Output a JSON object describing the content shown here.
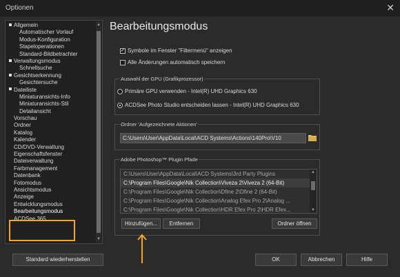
{
  "window": {
    "title": "Optionen",
    "close_glyph": "✕"
  },
  "sidebar": {
    "items": [
      {
        "label": "Allgemein",
        "level": 0,
        "square": true
      },
      {
        "label": "Automatischer Vorlauf",
        "level": 1
      },
      {
        "label": "Modus-Konfiguration",
        "level": 1
      },
      {
        "label": "Stapeloperationen",
        "level": 1
      },
      {
        "label": "Standard-Bildbetrachter",
        "level": 1
      },
      {
        "label": "Verwaltungsmodus",
        "level": 0,
        "square": true
      },
      {
        "label": "Schnellsuche",
        "level": 1
      },
      {
        "label": "Gesichtserkennung",
        "level": 0,
        "square": true
      },
      {
        "label": "Gesichtersuche",
        "level": 1
      },
      {
        "label": "Dateiliste",
        "level": 0,
        "square": true
      },
      {
        "label": "Miniaturansichts-Info",
        "level": 1
      },
      {
        "label": "Miniaturansichts-Stil",
        "level": 1
      },
      {
        "label": "Detailansicht",
        "level": 1
      },
      {
        "label": "Vorschau",
        "level": 0
      },
      {
        "label": "Ordner",
        "level": 0
      },
      {
        "label": "Katalog",
        "level": 0
      },
      {
        "label": "Kalender",
        "level": 0
      },
      {
        "label": "CD/DVD-Verwaltung",
        "level": 0
      },
      {
        "label": "Eigenschaftsfenster",
        "level": 0
      },
      {
        "label": "Dateiverwaltung",
        "level": 0
      },
      {
        "label": "Farbmanagement",
        "level": 0
      },
      {
        "label": "Datenbank",
        "level": 0
      },
      {
        "label": "Fotomodus",
        "level": 0
      },
      {
        "label": "Ansichtsmodus",
        "level": 0
      },
      {
        "label": "Anzeige",
        "level": 0
      },
      {
        "label": "Entwicklungsmodus",
        "level": 0
      },
      {
        "label": "Bearbeitungsmodus",
        "level": 0,
        "selected": true
      },
      {
        "label": "ACDSee 365",
        "level": 0
      }
    ]
  },
  "main": {
    "heading": "Bearbeitungsmodus",
    "checkbox1": {
      "label": "Symbole im Fenster \"Filtermenü\" anzeigen",
      "checked": true
    },
    "checkbox2": {
      "label": "Alle Änderungen automatisch speichern",
      "checked": false
    },
    "gpu_group": {
      "title": "Auswahl der GPU (Grafikprozessor)",
      "option1": "Primäre GPU verwenden - Intel(R) UHD Graphics 630",
      "option2": "ACDSee Photo Studio entscheiden lassen - Intel(R) UHD Graphics 630",
      "selected": 2
    },
    "actions_group": {
      "title": "Ordner 'Aufgezeichnete Aktionen'",
      "path": "C:\\Users\\User\\AppData\\Local\\ACD Systems\\Actions\\140Pro\\V10"
    },
    "plugins_group": {
      "title": "Adobe Photoshop™ Plugin Pfade",
      "paths": [
        "C:\\Users\\User\\AppData\\Local\\ACD Systems\\3rd Party Plugins",
        "C:\\Program Files\\Google\\Nik Collection\\Viveza 2\\Viveza 2 (64-Bit)",
        "C:\\Program Files\\Google\\Nik Collection\\Dfine 2\\Dfine 2 (64-Bit)",
        "C:\\Program Files\\Google\\Nik Collection\\Analog Efex Pro 2\\Analog ...",
        "C:\\Program Files\\Google\\Nik Collection\\HDR Efex Pro 2\\HDR Efex..."
      ],
      "selected_index": 1,
      "add_label": "Hinzufügen...",
      "remove_label": "Entfernen",
      "open_folder_label": "Ordner öffnen"
    }
  },
  "footer": {
    "restore_label": "Standard wiederherstellen",
    "ok_label": "OK",
    "cancel_label": "Abbrechen",
    "help_label": "Hilfe"
  },
  "colors": {
    "window_bg": "#2b2b2b",
    "titlebar_bg": "#1e1e1e",
    "annotation": "#f5a623",
    "folder_icon": "#e8c46a"
  },
  "icons": {
    "checkmark": "✓",
    "scroll_up": "▲",
    "scroll_down": "▼",
    "folder": "folder-icon",
    "annotation_arrow": "arrow-up-icon"
  }
}
